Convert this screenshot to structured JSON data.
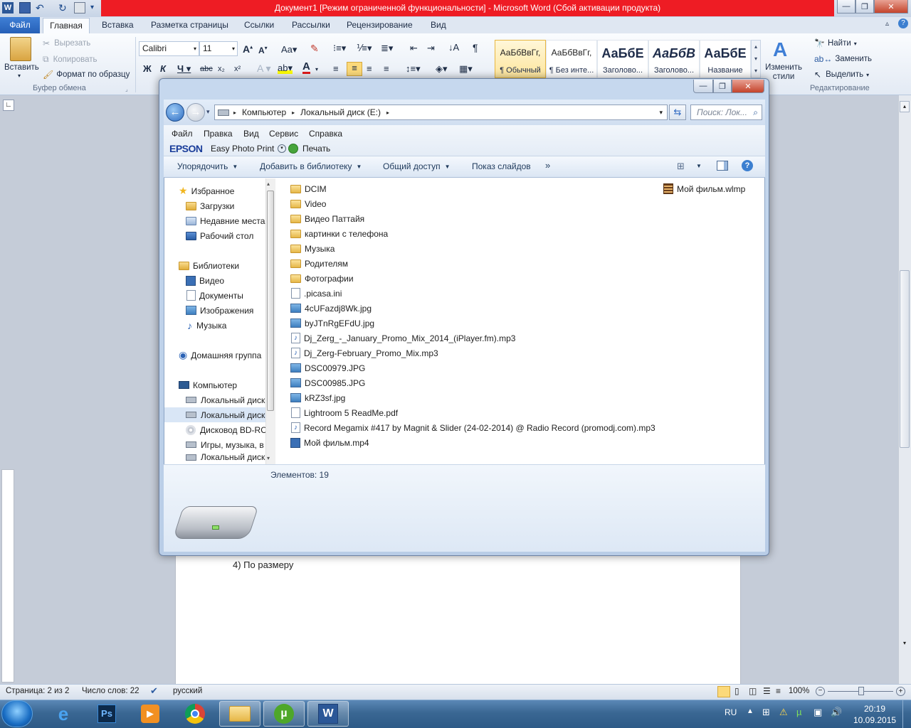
{
  "word": {
    "title": "Документ1 [Режим ограниченной функциональности]  -  Microsoft Word (Сбой активации продукта)",
    "tabs": [
      "Файл",
      "Главная",
      "Вставка",
      "Разметка страницы",
      "Ссылки",
      "Рассылки",
      "Рецензирование",
      "Вид"
    ],
    "clipboard": {
      "paste": "Вставить",
      "cut": "Вырезать",
      "copy": "Копировать",
      "format_painter": "Формат по образцу",
      "group": "Буфер обмена"
    },
    "font": {
      "name": "Calibri",
      "size": "11"
    },
    "styles": [
      {
        "preview": "АаБбВвГг,",
        "label": "¶ Обычный"
      },
      {
        "preview": "АаБбВвГг,",
        "label": "¶ Без инте..."
      },
      {
        "preview": "АаБбЕ",
        "label": "Заголово..."
      },
      {
        "preview": "АаБбВ",
        "label": "Заголово..."
      },
      {
        "preview": "АаБбЕ",
        "label": "Название"
      }
    ],
    "change_styles": "Изменить стили",
    "editing": {
      "find": "Найти",
      "replace": "Заменить",
      "select": "Выделить",
      "group": "Редактирование"
    },
    "doc_line": "4)    По размеру",
    "status": {
      "page": "Страница: 2 из 2",
      "words": "Число слов: 22",
      "lang": "русский",
      "zoom": "100%"
    }
  },
  "explorer": {
    "breadcrumb": [
      "Компьютер",
      "Локальный диск (E:)"
    ],
    "search_placeholder": "Поиск: Лок...",
    "menu": [
      "Файл",
      "Правка",
      "Вид",
      "Сервис",
      "Справка"
    ],
    "epson": {
      "brand": "EPSON",
      "app": "Easy Photo Print",
      "print": "Печать"
    },
    "toolbar": {
      "organize": "Упорядочить",
      "add_library": "Добавить в библиотеку",
      "share": "Общий доступ",
      "slideshow": "Показ слайдов",
      "more": "»"
    },
    "nav": {
      "favorites": "Избранное",
      "downloads": "Загрузки",
      "recent": "Недавние места",
      "desktop": "Рабочий стол",
      "libraries": "Библиотеки",
      "video": "Видео",
      "documents": "Документы",
      "images": "Изображения",
      "music": "Музыка",
      "homegroup": "Домашняя группа",
      "computer": "Компьютер",
      "disk1": "Локальный диск",
      "disk2": "Локальный диск",
      "bd": "Дисковод BD-RC",
      "games": "Игры, музыка, в",
      "disk3": "Локальный диск"
    },
    "files": [
      {
        "name": "DCIM",
        "type": "folder"
      },
      {
        "name": "Video",
        "type": "folder"
      },
      {
        "name": "Видео Паттайя",
        "type": "folder"
      },
      {
        "name": "картинки с  телефона",
        "type": "folder"
      },
      {
        "name": "Музыка",
        "type": "folder"
      },
      {
        "name": "Родителям",
        "type": "folder"
      },
      {
        "name": "Фотографии",
        "type": "folder"
      },
      {
        "name": ".picasa.ini",
        "type": "doc"
      },
      {
        "name": "4cUFazdj8Wk.jpg",
        "type": "img"
      },
      {
        "name": "byJTnRgEFdU.jpg",
        "type": "img"
      },
      {
        "name": "Dj_Zerg_-_January_Promo_Mix_2014_(iPlayer.fm).mp3",
        "type": "mp3"
      },
      {
        "name": "Dj_Zerg-February_Promo_Mix.mp3",
        "type": "mp3"
      },
      {
        "name": "DSC00979.JPG",
        "type": "img"
      },
      {
        "name": "DSC00985.JPG",
        "type": "img"
      },
      {
        "name": "kRZ3sf.jpg",
        "type": "img"
      },
      {
        "name": "Lightroom 5 ReadMe.pdf",
        "type": "pdf"
      },
      {
        "name": "Record Megamix #417 by Magnit & Slider (24-02-2014) @ Radio Record (promodj.com).mp3",
        "type": "mp3"
      },
      {
        "name": "Мой фильм.mp4",
        "type": "vid"
      }
    ],
    "file_right": "Мой фильм.wlmp",
    "items_count": "Элементов: 19"
  },
  "taskbar": {
    "lang": "RU",
    "time": "20:19",
    "date": "10.09.2015"
  }
}
